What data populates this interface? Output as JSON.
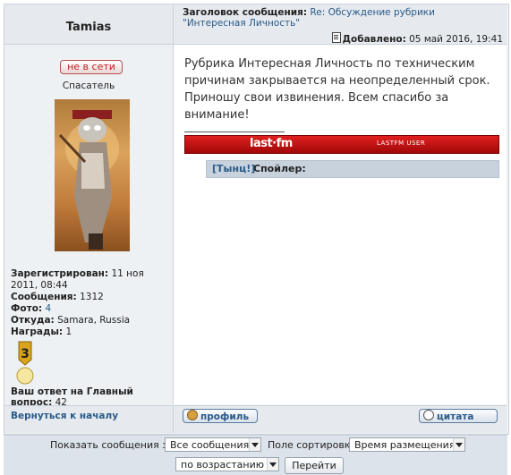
{
  "author": {
    "name": "Tamias",
    "status": "не в сети",
    "rank": "Спасатель",
    "registered_label": "Зарегистрирован:",
    "registered": "11 ноя 2011, 08:44",
    "posts_label": "Сообщения:",
    "posts": "1312",
    "photos_label": "Фото:",
    "photos": "4",
    "from_label": "Откуда:",
    "from": "Samara, Russia",
    "awards_label": "Награды:",
    "awards": "1",
    "medal_number": "3",
    "question_label": "Ваш ответ на Главный вопрос:",
    "question_answer": "42"
  },
  "post": {
    "subject_label": "Заголовок сообщения:",
    "subject": "Re: Обсуждение рубрики \"Интересная Личность\"",
    "posted_label": "Добавлено:",
    "posted": "05 май 2016, 19:41",
    "body": "Рубрика Интересная Личность по техническим причинам закрывается на неопределенный срок. Приношу свои извинения. Всем спасибо за внимание!",
    "lastfm_logo": "last·fm",
    "lastfm_user": "LASTFM USER",
    "spoiler_link": "[Тынц!]",
    "spoiler_label": "Спойлер:"
  },
  "footer": {
    "back_to_top": "Вернуться к началу",
    "profile_button": "профиль",
    "quote_button": "цитата"
  },
  "controls": {
    "show_label": "Показать сообщения за:",
    "show_value": "Все сообщения",
    "sort_label": "Поле сортировки",
    "sort_value": "Время размещения",
    "order_value": "по возрастанию",
    "go_button": "Перейти"
  },
  "colors": {
    "link": "#2a5a8a",
    "offline": "#c42020",
    "lastfm_red": "#d01010"
  }
}
